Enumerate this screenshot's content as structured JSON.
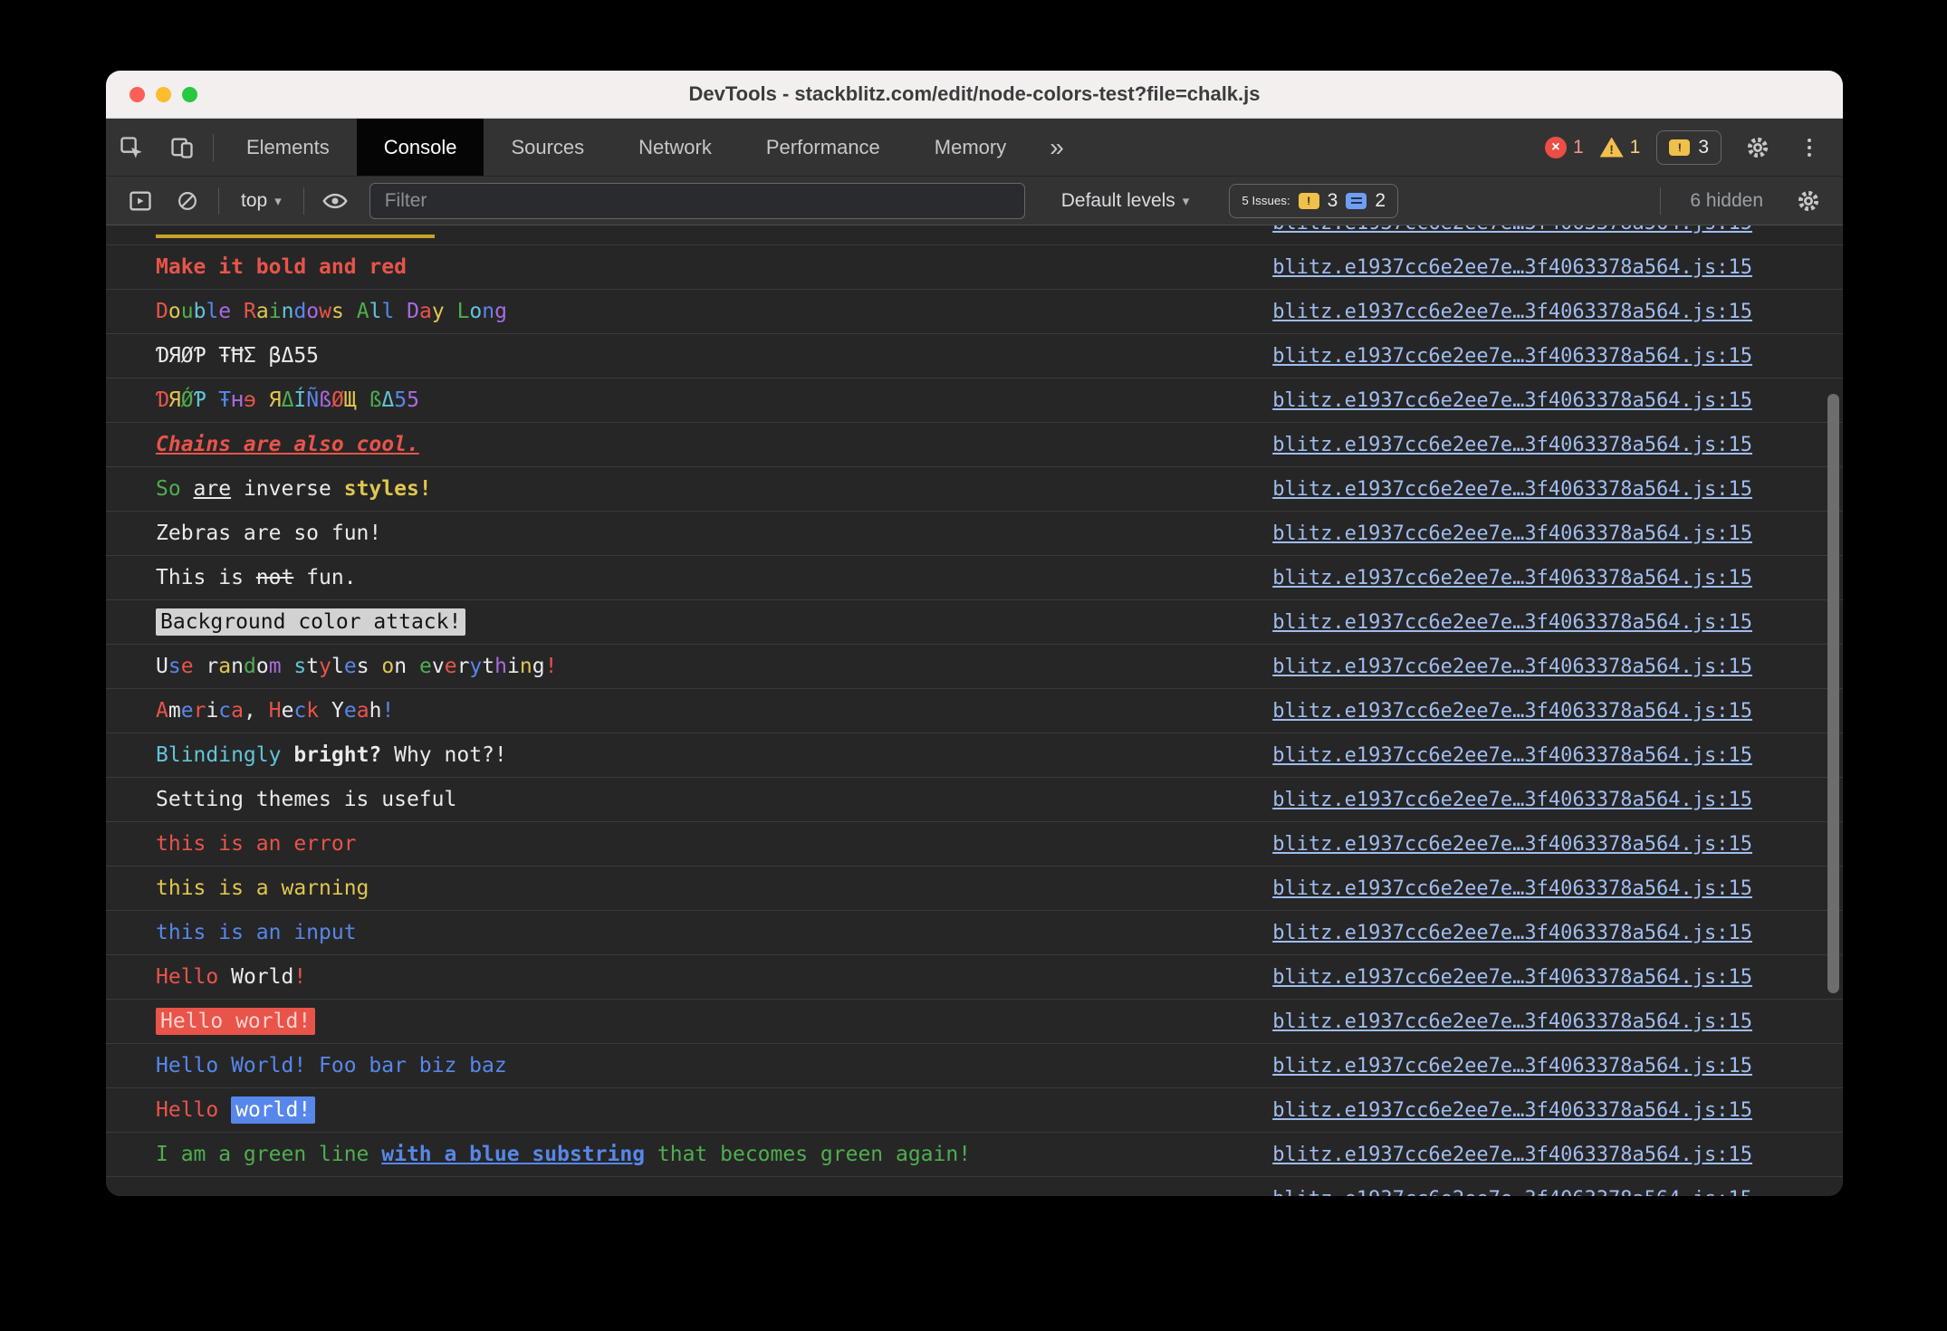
{
  "window": {
    "title": "DevTools - stackblitz.com/edit/node-colors-test?file=chalk.js"
  },
  "icons": {
    "more_tabs": "»",
    "dropdown": "▾",
    "error_x": "×",
    "bang": "!"
  },
  "status": {
    "errors": "1",
    "warnings": "1",
    "issues": "3"
  },
  "tabs": {
    "items": [
      {
        "label": "Elements"
      },
      {
        "label": "Console"
      },
      {
        "label": "Sources"
      },
      {
        "label": "Network"
      },
      {
        "label": "Performance"
      },
      {
        "label": "Memory"
      }
    ]
  },
  "toolbar": {
    "context": "top",
    "filter_placeholder": "Filter",
    "levels": "Default levels",
    "issues_label": "5 Issues:",
    "issues_breakpoint_count": "3",
    "issues_message_count": "2",
    "hidden_label": "6 hidden"
  },
  "console": {
    "link": "blitz.e1937cc6e2ee7e…3f4063378a564.js:15",
    "rows": [
      {
        "cls": "partial-top",
        "bar": true,
        "segments": []
      },
      {
        "segments": [
          {
            "t": "Make it bold and red",
            "c": "#e8544a",
            "b": 1
          }
        ]
      },
      {
        "segments": [
          {
            "t": "D",
            "c": "#e8544a"
          },
          {
            "t": "o",
            "c": "#e0c64f"
          },
          {
            "t": "u",
            "c": "#4fae4f"
          },
          {
            "t": "b",
            "c": "#62c3d8"
          },
          {
            "t": "l",
            "c": "#5787eb"
          },
          {
            "t": "e ",
            "c": "#a86be0"
          },
          {
            "t": "R",
            "c": "#e8544a"
          },
          {
            "t": "a",
            "c": "#e0c64f"
          },
          {
            "t": "i",
            "c": "#4fae4f"
          },
          {
            "t": "n",
            "c": "#62c3d8"
          },
          {
            "t": "d",
            "c": "#5787eb"
          },
          {
            "t": "o",
            "c": "#a86be0"
          },
          {
            "t": "w",
            "c": "#e8544a"
          },
          {
            "t": "s ",
            "c": "#e0c64f"
          },
          {
            "t": "A",
            "c": "#4fae4f"
          },
          {
            "t": "l",
            "c": "#62c3d8"
          },
          {
            "t": "l ",
            "c": "#5787eb"
          },
          {
            "t": "D",
            "c": "#a86be0"
          },
          {
            "t": "a",
            "c": "#e8544a"
          },
          {
            "t": "y ",
            "c": "#e0c64f"
          },
          {
            "t": "L",
            "c": "#4fae4f"
          },
          {
            "t": "o",
            "c": "#62c3d8"
          },
          {
            "t": "n",
            "c": "#5787eb"
          },
          {
            "t": "g",
            "c": "#a86be0"
          }
        ]
      },
      {
        "segments": [
          {
            "t": "ƊЯØƤ ŦĦΣ βΔ55",
            "c": "#e8eaed"
          }
        ]
      },
      {
        "segments": [
          {
            "t": "Ɗ",
            "c": "#e8544a"
          },
          {
            "t": "Я",
            "c": "#e0c64f"
          },
          {
            "t": "Ǿ",
            "c": "#4fae4f"
          },
          {
            "t": "Ƥ ",
            "c": "#62c3d8"
          },
          {
            "t": "Ŧ",
            "c": "#5787eb"
          },
          {
            "t": "ʜ",
            "c": "#a86be0"
          },
          {
            "t": "ɘ ",
            "c": "#e8544a"
          },
          {
            "t": "Я",
            "c": "#e0c64f"
          },
          {
            "t": "Δ",
            "c": "#4fae4f"
          },
          {
            "t": "Í",
            "c": "#62c3d8"
          },
          {
            "t": "Ñ",
            "c": "#5787eb"
          },
          {
            "t": "ß",
            "c": "#a86be0"
          },
          {
            "t": "Ø",
            "c": "#e8544a"
          },
          {
            "t": "Щ ",
            "c": "#e0c64f"
          },
          {
            "t": "ß",
            "c": "#4fae4f"
          },
          {
            "t": "Δ",
            "c": "#62c3d8"
          },
          {
            "t": "5",
            "c": "#5787eb"
          },
          {
            "t": "5",
            "c": "#a86be0"
          }
        ]
      },
      {
        "segments": [
          {
            "t": "Chains are also cool.",
            "c": "#e8544a",
            "b": 1,
            "i": 1,
            "u": 1
          }
        ]
      },
      {
        "segments": [
          {
            "t": "So ",
            "c": "#4fae4f"
          },
          {
            "t": "are",
            "c": "#e8eaed",
            "u": 1
          },
          {
            "t": " inverse ",
            "c": "#e8eaed"
          },
          {
            "t": "styles!",
            "c": "#e0c64f",
            "b": 1
          }
        ]
      },
      {
        "segments": [
          {
            "t": "Zebras are so fun!",
            "c": "#e8eaed"
          }
        ]
      },
      {
        "segments": [
          {
            "t": "This is ",
            "c": "#e8eaed"
          },
          {
            "t": "not",
            "c": "#e8eaed",
            "s": 1
          },
          {
            "t": " fun.",
            "c": "#e8eaed"
          }
        ]
      },
      {
        "segments": [
          {
            "t": "Background color attack!",
            "c": "#141414",
            "bg": "#d2d2d2"
          }
        ]
      },
      {
        "segments": [
          {
            "t": "U",
            "c": "#e8eaed"
          },
          {
            "t": "s",
            "c": "#5787eb"
          },
          {
            "t": "e ",
            "c": "#e8544a"
          },
          {
            "t": "r",
            "c": "#e8eaed"
          },
          {
            "t": "a",
            "c": "#e0c64f"
          },
          {
            "t": "n",
            "c": "#e8eaed"
          },
          {
            "t": "d",
            "c": "#4fae4f"
          },
          {
            "t": "o",
            "c": "#e8eaed"
          },
          {
            "t": "m ",
            "c": "#a86be0"
          },
          {
            "t": "s",
            "c": "#62c3d8"
          },
          {
            "t": "t",
            "c": "#e8eaed"
          },
          {
            "t": "y",
            "c": "#e8544a"
          },
          {
            "t": "l",
            "c": "#e8eaed"
          },
          {
            "t": "e",
            "c": "#5787eb"
          },
          {
            "t": "s ",
            "c": "#e8eaed"
          },
          {
            "t": "o",
            "c": "#e0c64f"
          },
          {
            "t": "n ",
            "c": "#e8eaed"
          },
          {
            "t": "e",
            "c": "#4fae4f"
          },
          {
            "t": "v",
            "c": "#e8eaed"
          },
          {
            "t": "e",
            "c": "#e8544a"
          },
          {
            "t": "r",
            "c": "#e8eaed"
          },
          {
            "t": "y",
            "c": "#5787eb"
          },
          {
            "t": "t",
            "c": "#e8eaed"
          },
          {
            "t": "h",
            "c": "#a86be0"
          },
          {
            "t": "i",
            "c": "#e8eaed"
          },
          {
            "t": "n",
            "c": "#e0c64f"
          },
          {
            "t": "g",
            "c": "#e8eaed"
          },
          {
            "t": "!",
            "c": "#e8544a"
          }
        ]
      },
      {
        "segments": [
          {
            "t": "A",
            "c": "#e8544a"
          },
          {
            "t": "m",
            "c": "#e8eaed"
          },
          {
            "t": "e",
            "c": "#5787eb"
          },
          {
            "t": "r",
            "c": "#e8544a"
          },
          {
            "t": "i",
            "c": "#e8eaed"
          },
          {
            "t": "c",
            "c": "#5787eb"
          },
          {
            "t": "a",
            "c": "#e8544a"
          },
          {
            "t": ", ",
            "c": "#e8eaed"
          },
          {
            "t": "H",
            "c": "#e8544a"
          },
          {
            "t": "e",
            "c": "#e8eaed"
          },
          {
            "t": "c",
            "c": "#5787eb"
          },
          {
            "t": "k ",
            "c": "#e8544a"
          },
          {
            "t": "Y",
            "c": "#e8eaed"
          },
          {
            "t": "e",
            "c": "#5787eb"
          },
          {
            "t": "a",
            "c": "#e8544a"
          },
          {
            "t": "h",
            "c": "#e8eaed"
          },
          {
            "t": "!",
            "c": "#5787eb"
          }
        ]
      },
      {
        "segments": [
          {
            "t": "Blindingly ",
            "c": "#62c3d8"
          },
          {
            "t": "bright? ",
            "c": "#e8eaed",
            "b": 1
          },
          {
            "t": "Why not?!",
            "c": "#e8eaed"
          }
        ]
      },
      {
        "segments": [
          {
            "t": "Setting themes is useful",
            "c": "#e8eaed"
          }
        ]
      },
      {
        "segments": [
          {
            "t": "this is an error",
            "c": "#e8544a"
          }
        ]
      },
      {
        "segments": [
          {
            "t": "this is a warning",
            "c": "#e0c64f"
          }
        ]
      },
      {
        "segments": [
          {
            "t": "this is an input",
            "c": "#5787eb"
          }
        ]
      },
      {
        "segments": [
          {
            "t": "Hello",
            "c": "#e8544a"
          },
          {
            "t": " World",
            "c": "#e8eaed"
          },
          {
            "t": "!",
            "c": "#e8544a"
          }
        ]
      },
      {
        "segments": [
          {
            "t": "Hello world!",
            "c": "#ffd2cf",
            "bg": "#e8544a"
          }
        ]
      },
      {
        "segments": [
          {
            "t": "Hello World! Foo bar biz baz",
            "c": "#5787eb"
          }
        ]
      },
      {
        "segments": [
          {
            "t": "Hello ",
            "c": "#e8544a"
          },
          {
            "t": "world!",
            "c": "#ffffff",
            "bg": "#5787eb"
          }
        ]
      },
      {
        "segments": [
          {
            "t": "I am a green line ",
            "c": "#4fae4f"
          },
          {
            "t": "with a blue substring",
            "c": "#5787eb",
            "b": 1,
            "u": 1
          },
          {
            "t": " that becomes green again!",
            "c": "#4fae4f"
          }
        ]
      },
      {
        "cls": "partial-bottom",
        "segments": []
      }
    ]
  }
}
